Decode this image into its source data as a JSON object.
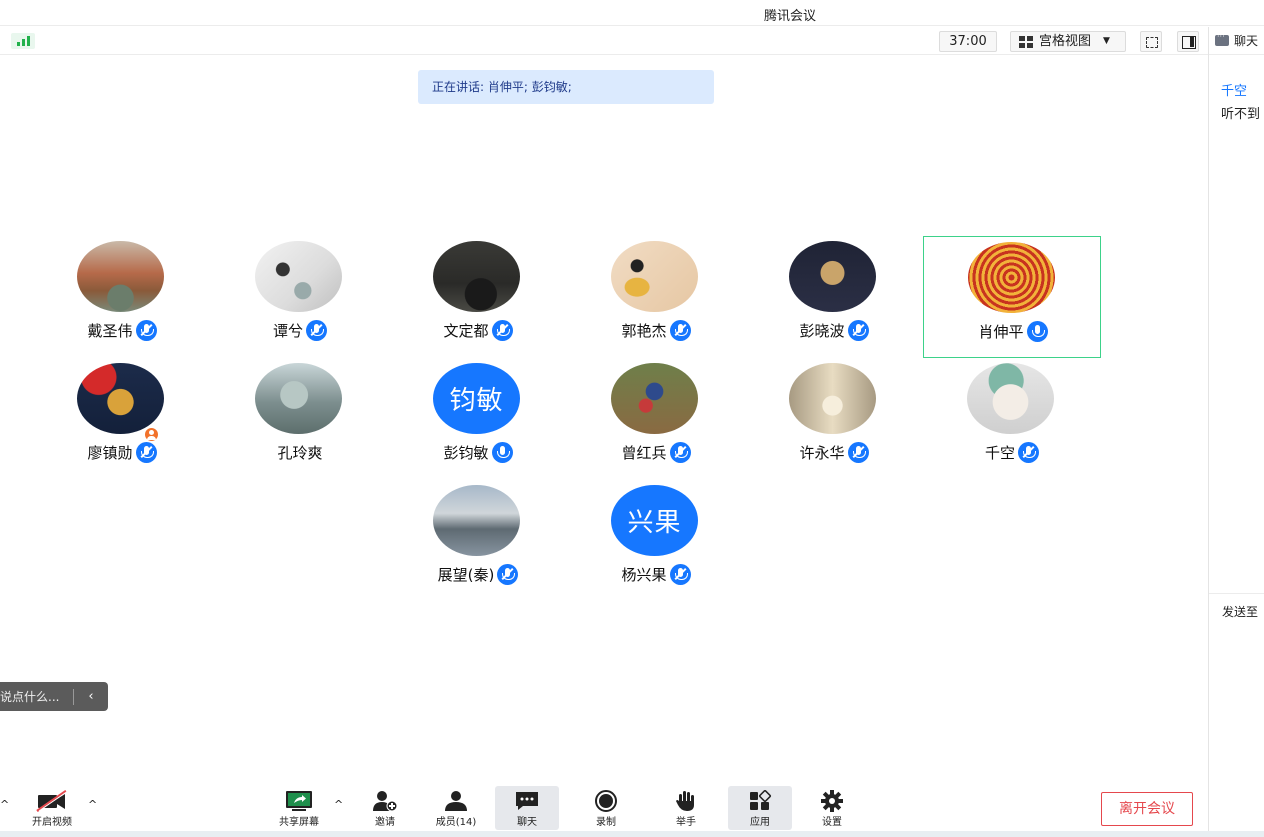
{
  "app": {
    "title": "腾讯会议"
  },
  "toolbar": {
    "timer": "37:00",
    "view_label": "宫格视图"
  },
  "chat_panel": {
    "header": "聊天",
    "message_sender": "千空",
    "message_text": "听不到",
    "send_to_label": "发送至"
  },
  "speaking": {
    "text": "正在讲话: 肖伸平; 彭钧敏;"
  },
  "participants": [
    {
      "name": "戴圣伟",
      "mic": "muted"
    },
    {
      "name": "谭兮",
      "mic": "muted"
    },
    {
      "name": "文定都",
      "mic": "muted"
    },
    {
      "name": "郭艳杰",
      "mic": "muted"
    },
    {
      "name": "彭晓波",
      "mic": "muted"
    },
    {
      "name": "肖伸平",
      "mic": "on",
      "active": true
    },
    {
      "name": "廖镇勋",
      "mic": "muted"
    },
    {
      "name": "孔玲爽",
      "mic": "none"
    },
    {
      "name": "彭钧敏",
      "mic": "on",
      "avatar_text": "钧敏"
    },
    {
      "name": "曾红兵",
      "mic": "muted"
    },
    {
      "name": "许永华",
      "mic": "muted"
    },
    {
      "name": "千空",
      "mic": "muted"
    },
    {
      "name": "展望(秦)",
      "mic": "muted"
    },
    {
      "name": "杨兴果",
      "mic": "muted",
      "avatar_text": "兴果"
    }
  ],
  "chat_input": {
    "placeholder": "说点什么..."
  },
  "bottom": {
    "video": "开启视频",
    "share": "共享屏幕",
    "invite": "邀请",
    "members": "成员(14)",
    "chat": "聊天",
    "record": "录制",
    "raise_hand": "举手",
    "apps": "应用",
    "settings": "设置",
    "leave": "离开会议"
  },
  "colors": {
    "accent": "#1677ff",
    "active_border": "#3dd28a",
    "leave": "#e5484d"
  }
}
